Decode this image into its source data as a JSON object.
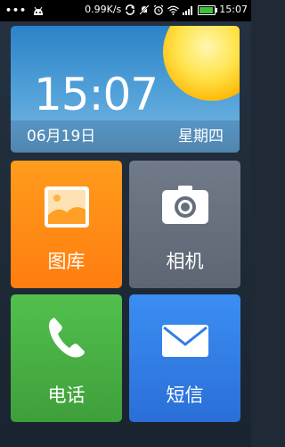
{
  "status_bar": {
    "menu_dots": "•••",
    "speed": "0.99K/s",
    "time": "15:07",
    "icons": [
      "android-icon",
      "data-sync-icon",
      "mute-icon",
      "alarm-icon",
      "wifi-icon",
      "signal-icon",
      "battery-icon"
    ]
  },
  "clock": {
    "time": "15:07",
    "date": "06月19日",
    "weekday": "星期四"
  },
  "tiles": [
    {
      "label": "图库",
      "icon": "gallery-icon",
      "color": "#ff8c14"
    },
    {
      "label": "相机",
      "icon": "camera-icon",
      "color": "#666f7c"
    },
    {
      "label": "电话",
      "icon": "phone-icon",
      "color": "#47ad43"
    },
    {
      "label": "短信",
      "icon": "sms-icon",
      "color": "#327ee4"
    }
  ]
}
